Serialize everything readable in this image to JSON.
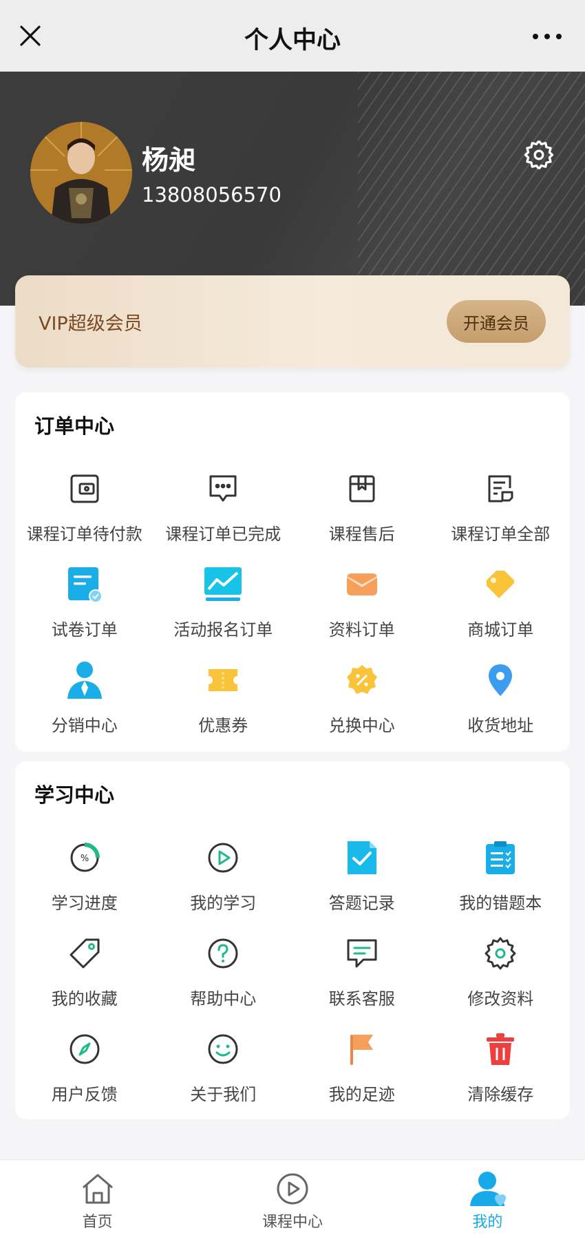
{
  "nav": {
    "title": "个人中心"
  },
  "profile": {
    "name": "杨昶",
    "phone": "13808056570"
  },
  "vip": {
    "label": "VIP超级会员",
    "button": "开通会员"
  },
  "orders": {
    "title": "订单中心",
    "items": [
      {
        "label": "课程订单待付款",
        "icon": "wallet-icon"
      },
      {
        "label": "课程订单已完成",
        "icon": "chat-bubble-icon"
      },
      {
        "label": "课程售后",
        "icon": "box-icon"
      },
      {
        "label": "课程订单全部",
        "icon": "document-list-icon"
      },
      {
        "label": "试卷订单",
        "icon": "exam-paper-icon"
      },
      {
        "label": "活动报名订单",
        "icon": "chart-monitor-icon"
      },
      {
        "label": "资料订单",
        "icon": "envelope-icon"
      },
      {
        "label": "商城订单",
        "icon": "tag-icon"
      },
      {
        "label": "分销中心",
        "icon": "user-tie-icon"
      },
      {
        "label": "优惠券",
        "icon": "ticket-icon"
      },
      {
        "label": "兑换中心",
        "icon": "percent-badge-icon"
      },
      {
        "label": "收货地址",
        "icon": "location-pin-icon"
      }
    ]
  },
  "study": {
    "title": "学习中心",
    "items": [
      {
        "label": "学习进度",
        "icon": "progress-ring-icon"
      },
      {
        "label": "我的学习",
        "icon": "play-circle-icon"
      },
      {
        "label": "答题记录",
        "icon": "checked-file-icon"
      },
      {
        "label": "我的错题本",
        "icon": "clipboard-list-icon"
      },
      {
        "label": "我的收藏",
        "icon": "bookmark-tag-icon"
      },
      {
        "label": "帮助中心",
        "icon": "question-circle-icon"
      },
      {
        "label": "联系客服",
        "icon": "message-icon"
      },
      {
        "label": "修改资料",
        "icon": "gear-icon"
      },
      {
        "label": "用户反馈",
        "icon": "compass-icon"
      },
      {
        "label": "关于我们",
        "icon": "smile-icon"
      },
      {
        "label": "我的足迹",
        "icon": "flag-icon"
      },
      {
        "label": "清除缓存",
        "icon": "trash-icon"
      }
    ]
  },
  "tabs": [
    {
      "label": "首页",
      "icon": "home-icon"
    },
    {
      "label": "课程中心",
      "icon": "play-circle-icon"
    },
    {
      "label": "我的",
      "icon": "user-icon",
      "active": true
    }
  ],
  "colors": {
    "accent": "#18a9e8",
    "green": "#1fb98a",
    "vip_text": "#7a4a22",
    "header_bg": "#3d3d3d"
  }
}
